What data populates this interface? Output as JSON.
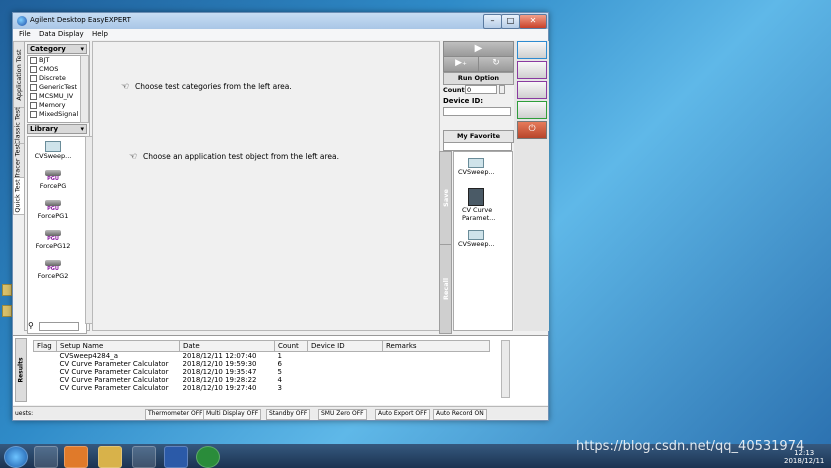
{
  "window": {
    "title": "Agilent Desktop EasyEXPERT"
  },
  "menu": [
    "File",
    "Data Display",
    "Help"
  ],
  "left_tabs": [
    "Application Test",
    "Classic Test",
    "Tracer Test",
    "Quick Test"
  ],
  "category": {
    "header": "Category",
    "items": [
      "BJT",
      "CMOS",
      "Discrete",
      "GenericTest",
      "MCSMU_IV",
      "Memory",
      "MixedSignal"
    ]
  },
  "library": {
    "header": "Library",
    "items": [
      {
        "label": "CVSweep...",
        "badge": ""
      },
      {
        "label": "ForcePG",
        "badge": "PGU"
      },
      {
        "label": "ForcePG1",
        "badge": "PGU"
      },
      {
        "label": "ForcePG12",
        "badge": "PGU"
      },
      {
        "label": "ForcePG2",
        "badge": "PGU"
      }
    ],
    "search_icon": "binoculars-icon"
  },
  "main": {
    "hint1": "Choose test categories from the left area.",
    "hint2": "Choose an application test object from the left area."
  },
  "run_panel": {
    "run_option": "Run Option",
    "count_label": "Count:",
    "count_value": "0",
    "device_id_label": "Device ID:",
    "device_id_value": "",
    "favorites_label": "My Favorite Setup",
    "favorites": [
      "CVSweep...",
      "CV Curve Paramet...",
      "CVSweep..."
    ],
    "save_label": "Save",
    "recall_label": "Recall"
  },
  "results": {
    "side_label": "Results",
    "columns": [
      "Flag",
      "Setup Name",
      "Date",
      "Count",
      "Device ID",
      "Remarks"
    ],
    "rows": [
      [
        "",
        "CVSweep4284_a",
        "2018/12/11 12:07:40",
        "1",
        "",
        ""
      ],
      [
        "",
        "CV Curve Parameter Calculator",
        "2018/12/10 19:59:30",
        "6",
        "",
        ""
      ],
      [
        "",
        "CV Curve Parameter Calculator",
        "2018/12/10 19:35:47",
        "5",
        "",
        ""
      ],
      [
        "",
        "CV Curve Parameter Calculator",
        "2018/12/10 19:28:22",
        "4",
        "",
        ""
      ],
      [
        "",
        "CV Curve Parameter Calculator",
        "2018/12/10 19:27:40",
        "3",
        "",
        ""
      ]
    ]
  },
  "statusbar": {
    "left": "uests:",
    "items": [
      "Thermometer OFF",
      "Multi Display OFF",
      "Standby OFF",
      "SMU Zero OFF",
      "Auto Export OFF",
      "Auto Record ON"
    ]
  },
  "taskbar": {
    "watermark": "https://blog.csdn.net/qq_40531974",
    "time": "12:13",
    "date": "2018/12/11"
  },
  "colors": {
    "desktop": "#2f8bc8",
    "favorites_header": "#e0e0e0",
    "pgu_label": "#8a1aa0"
  }
}
